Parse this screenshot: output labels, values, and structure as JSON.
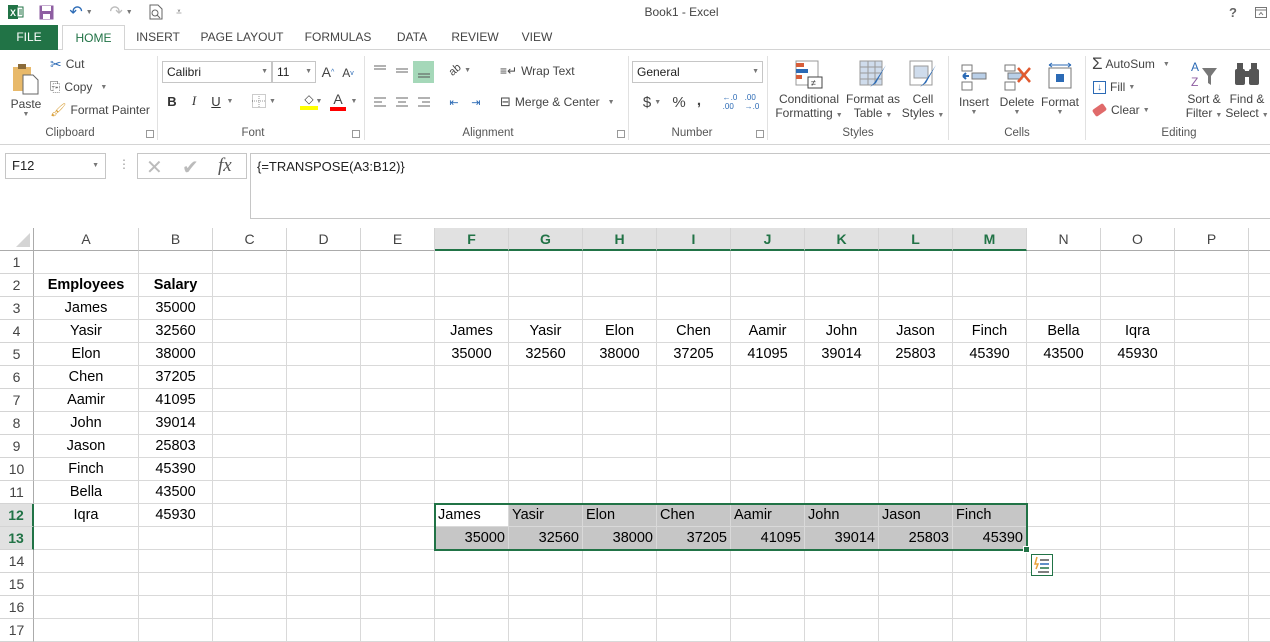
{
  "window": {
    "title": "Book1 - Excel",
    "help_label": "?",
    "icons": [
      "excel-logo-icon",
      "save-icon",
      "undo-icon",
      "redo-icon",
      "print-preview-icon",
      "customize-qat-icon",
      "help-icon",
      "ribbon-display-icon"
    ]
  },
  "tabs": [
    {
      "label": "FILE"
    },
    {
      "label": "HOME"
    },
    {
      "label": "INSERT"
    },
    {
      "label": "PAGE LAYOUT"
    },
    {
      "label": "FORMULAS"
    },
    {
      "label": "DATA"
    },
    {
      "label": "REVIEW"
    },
    {
      "label": "VIEW"
    }
  ],
  "active_tab": "HOME",
  "ribbon": {
    "clipboard": {
      "label": "Clipboard",
      "paste": "Paste",
      "cut": "Cut",
      "copy": "Copy",
      "format_painter": "Format Painter"
    },
    "font": {
      "label": "Font",
      "font_name": "Calibri",
      "font_size": "11",
      "bold": "B",
      "italic": "I",
      "underline": "U",
      "fill_color": "#ffff00",
      "font_color": "#ff0000"
    },
    "alignment": {
      "label": "Alignment",
      "wrap_text": "Wrap Text",
      "merge_center": "Merge & Center"
    },
    "number": {
      "label": "Number",
      "format": "General",
      "currency": "$",
      "percent": "%",
      "comma": ","
    },
    "styles": {
      "label": "Styles",
      "conditional_formatting": [
        "Conditional",
        "Formatting"
      ],
      "format_as_table": [
        "Format as",
        "Table"
      ],
      "cell_styles": [
        "Cell",
        "Styles"
      ]
    },
    "cells": {
      "label": "Cells",
      "insert": "Insert",
      "delete": "Delete",
      "format": "Format"
    },
    "editing": {
      "label": "Editing",
      "autosum": "AutoSum",
      "fill": "Fill",
      "clear": "Clear",
      "sort_filter": [
        "Sort &",
        "Filter"
      ],
      "find_select": [
        "Find &",
        "Select"
      ]
    }
  },
  "formula_bar": {
    "name_box": "F12",
    "fx_label": "fx",
    "formula": "{=TRANSPOSE(A3:B12)}"
  },
  "grid": {
    "columns": [
      "A",
      "B",
      "C",
      "D",
      "E",
      "F",
      "G",
      "H",
      "I",
      "J",
      "K",
      "L",
      "M",
      "N",
      "O",
      "P"
    ],
    "selected_columns": [
      "F",
      "G",
      "H",
      "I",
      "J",
      "K",
      "L",
      "M"
    ],
    "rows": [
      "1",
      "2",
      "3",
      "4",
      "5",
      "6",
      "7",
      "8",
      "9",
      "10",
      "11",
      "12",
      "13",
      "14",
      "15",
      "16",
      "17"
    ],
    "selected_rows": [
      "12",
      "13"
    ],
    "headers": {
      "A2": "Employees",
      "B2": "Salary"
    },
    "employees": [
      {
        "name": "James",
        "salary": "35000"
      },
      {
        "name": "Yasir",
        "salary": "32560"
      },
      {
        "name": "Elon",
        "salary": "38000"
      },
      {
        "name": "Chen",
        "salary": "37205"
      },
      {
        "name": "Aamir",
        "salary": "41095"
      },
      {
        "name": "John",
        "salary": "39014"
      },
      {
        "name": "Jason",
        "salary": "25803"
      },
      {
        "name": "Finch",
        "salary": "45390"
      },
      {
        "name": "Bella",
        "salary": "43500"
      },
      {
        "name": "Iqra",
        "salary": "45930"
      }
    ],
    "transposed_row4": [
      "James",
      "Yasir",
      "Elon",
      "Chen",
      "Aamir",
      "John",
      "Jason",
      "Finch",
      "Bella",
      "Iqra"
    ],
    "transposed_row5": [
      "35000",
      "32560",
      "38000",
      "37205",
      "41095",
      "39014",
      "25803",
      "45390",
      "43500",
      "45930"
    ],
    "selection_row12": [
      "James",
      "Yasir",
      "Elon",
      "Chen",
      "Aamir",
      "John",
      "Jason",
      "Finch"
    ],
    "selection_row13": [
      "35000",
      "32560",
      "38000",
      "37205",
      "41095",
      "39014",
      "25803",
      "45390"
    ],
    "active_cell": "F12",
    "selection_range": "F12:M13"
  },
  "colors": {
    "excel_green": "#217346",
    "selection_fill": "#c6c6c6",
    "header_selected": "#e1e1e1"
  }
}
